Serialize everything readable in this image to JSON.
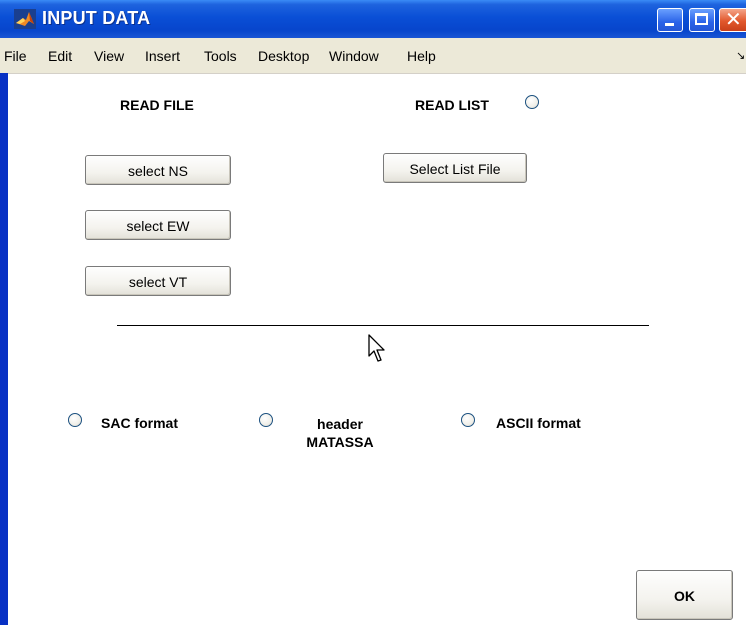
{
  "window": {
    "title": "INPUT DATA"
  },
  "menu": [
    "File",
    "Edit",
    "View",
    "Insert",
    "Tools",
    "Desktop",
    "Window",
    "Help"
  ],
  "read_file": {
    "heading": "READ FILE",
    "buttons": [
      "select NS",
      "select EW",
      "select VT"
    ]
  },
  "read_list": {
    "heading": "READ LIST",
    "button": "Select List File",
    "selected": false
  },
  "format_options": [
    {
      "label": "SAC format",
      "selected": false
    },
    {
      "label": "header MATASSA",
      "selected": false
    },
    {
      "label": "ASCII format",
      "selected": false
    }
  ],
  "ok_button": "OK",
  "icons": {
    "app": "matlab-logo-icon",
    "minimize": "minimize-icon",
    "maximize": "maximize-icon",
    "close": "close-icon",
    "menu_overflow": "overflow-arrow-icon",
    "cursor": "mouse-pointer-icon"
  },
  "colors": {
    "titlebar": "#0a4fd6",
    "menubar": "#ece9d8",
    "client": "#ffffff"
  }
}
